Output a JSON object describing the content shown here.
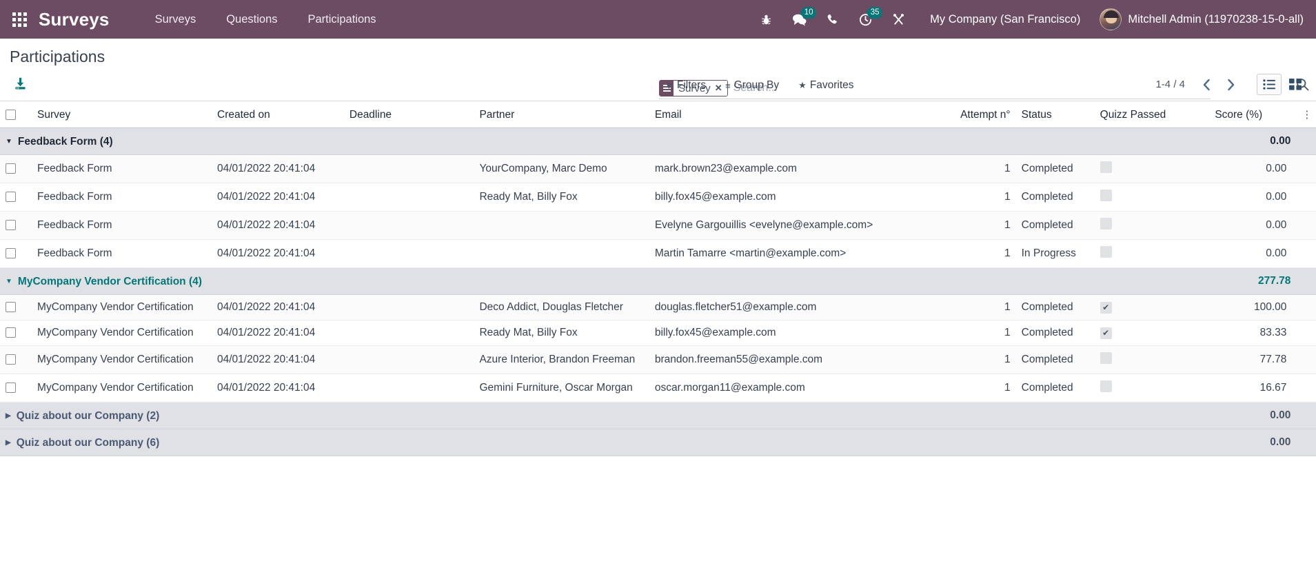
{
  "navbar": {
    "apps_icon": "grid-apps-icon",
    "brand": "Surveys",
    "menu": [
      {
        "label": "Surveys"
      },
      {
        "label": "Questions"
      },
      {
        "label": "Participations"
      }
    ],
    "systray": [
      {
        "name": "bug-icon",
        "badge": null
      },
      {
        "name": "messages-icon",
        "badge": "10"
      },
      {
        "name": "phone-icon",
        "badge": null
      },
      {
        "name": "activities-clock-icon",
        "badge": "35"
      },
      {
        "name": "tools-icon",
        "badge": null
      }
    ],
    "company": "My Company (San Francisco)",
    "user": "Mitchell Admin (11970238-15-0-all)"
  },
  "control_panel": {
    "title": "Participations",
    "export_icon": "download-icon",
    "search": {
      "facet_label": "Survey",
      "facet_icon": "group-by-icon",
      "facet_close": "✕",
      "placeholder": "Search...",
      "value": "",
      "magnifier_icon": "search-icon"
    },
    "buttons": [
      {
        "label": "Filters",
        "icon": "filter-icon"
      },
      {
        "label": "Group By",
        "icon": "lines-icon"
      },
      {
        "label": "Favorites",
        "icon": "star-icon"
      }
    ],
    "pager": {
      "count": "1-4 / 4",
      "prev_icon": "chevron-left-icon",
      "next_icon": "chevron-right-icon"
    },
    "views": [
      {
        "name": "list-view",
        "icon": "list-icon",
        "active": true
      },
      {
        "name": "kanban-view",
        "icon": "kanban-icon",
        "active": false
      }
    ]
  },
  "table": {
    "columns": [
      "Survey",
      "Created on",
      "Deadline",
      "Partner",
      "Email",
      "Attempt n°",
      "Status",
      "Quizz Passed",
      "Score (%)"
    ],
    "optional_columns_icon": "vertical-dots-icon",
    "groups": [
      {
        "label": "Feedback Form (4)",
        "expanded": true,
        "color": "dark",
        "aggregate_score": "0.00",
        "rows": [
          {
            "survey": "Feedback Form",
            "created_on": "04/01/2022 20:41:04",
            "deadline": "",
            "partner": "YourCompany, Marc Demo",
            "email": "mark.brown23@example.com",
            "attempt": "1",
            "status": "Completed",
            "quizz_passed": false,
            "score": "0.00"
          },
          {
            "survey": "Feedback Form",
            "created_on": "04/01/2022 20:41:04",
            "deadline": "",
            "partner": "Ready Mat, Billy Fox",
            "email": "billy.fox45@example.com",
            "attempt": "1",
            "status": "Completed",
            "quizz_passed": false,
            "score": "0.00"
          },
          {
            "survey": "Feedback Form",
            "created_on": "04/01/2022 20:41:04",
            "deadline": "",
            "partner": "",
            "email": "Evelyne Gargouillis <evelyne@example.com>",
            "attempt": "1",
            "status": "Completed",
            "quizz_passed": false,
            "score": "0.00"
          },
          {
            "survey": "Feedback Form",
            "created_on": "04/01/2022 20:41:04",
            "deadline": "",
            "partner": "",
            "email": "Martin Tamarre <martin@example.com>",
            "attempt": "1",
            "status": "In Progress",
            "quizz_passed": false,
            "score": "0.00"
          }
        ]
      },
      {
        "label": "MyCompany Vendor Certification (4)",
        "expanded": true,
        "color": "teal",
        "aggregate_score": "277.78",
        "rows": [
          {
            "survey": "MyCompany Vendor Certification",
            "created_on": "04/01/2022 20:41:04",
            "deadline": "",
            "partner": "Deco Addict, Douglas Fletcher",
            "email": "douglas.fletcher51@example.com",
            "attempt": "1",
            "status": "Completed",
            "quizz_passed": true,
            "score": "100.00"
          },
          {
            "survey": "MyCompany Vendor Certification",
            "created_on": "04/01/2022 20:41:04",
            "deadline": "",
            "partner": "Ready Mat, Billy Fox",
            "email": "billy.fox45@example.com",
            "attempt": "1",
            "status": "Completed",
            "quizz_passed": true,
            "score": "83.33"
          },
          {
            "survey": "MyCompany Vendor Certification",
            "created_on": "04/01/2022 20:41:04",
            "deadline": "",
            "partner": "Azure Interior, Brandon Freeman",
            "email": "brandon.freeman55@example.com",
            "attempt": "1",
            "status": "Completed",
            "quizz_passed": false,
            "score": "77.78"
          },
          {
            "survey": "MyCompany Vendor Certification",
            "created_on": "04/01/2022 20:41:04",
            "deadline": "",
            "partner": "Gemini Furniture, Oscar Morgan",
            "email": "oscar.morgan11@example.com",
            "attempt": "1",
            "status": "Completed",
            "quizz_passed": false,
            "score": "16.67"
          }
        ]
      },
      {
        "label": "Quiz about our Company (2)",
        "expanded": false,
        "color": "slate",
        "aggregate_score": "0.00",
        "rows": []
      },
      {
        "label": "Quiz about our Company (6)",
        "expanded": false,
        "color": "slate",
        "aggregate_score": "0.00",
        "rows": []
      }
    ]
  },
  "colors": {
    "brand_purple": "#6b4c63",
    "accent_teal": "#00787a",
    "group_bg": "#dfe1e5",
    "text": "#374151"
  }
}
